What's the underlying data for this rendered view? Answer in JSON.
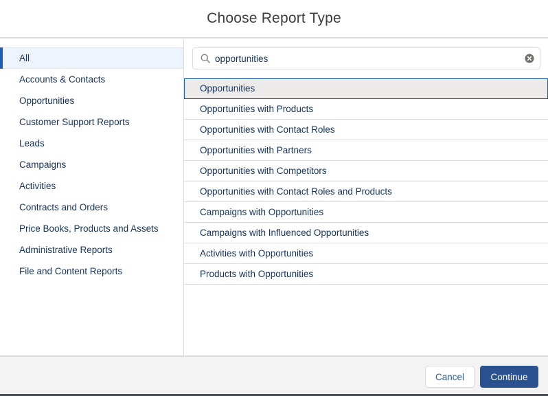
{
  "dialog": {
    "title": "Choose Report Type"
  },
  "sidebar": {
    "items": [
      {
        "label": "All",
        "active": true
      },
      {
        "label": "Accounts & Contacts"
      },
      {
        "label": "Opportunities"
      },
      {
        "label": "Customer Support Reports"
      },
      {
        "label": "Leads"
      },
      {
        "label": "Campaigns"
      },
      {
        "label": "Activities"
      },
      {
        "label": "Contracts and Orders"
      },
      {
        "label": "Price Books, Products and Assets"
      },
      {
        "label": "Administrative Reports"
      },
      {
        "label": "File and Content Reports"
      }
    ]
  },
  "search": {
    "value": "opportunities",
    "icon": "search-icon",
    "clear_icon": "clear-icon"
  },
  "results": {
    "items": [
      {
        "label": "Opportunities",
        "selected": true
      },
      {
        "label": "Opportunities with Products"
      },
      {
        "label": "Opportunities with Contact Roles"
      },
      {
        "label": "Opportunities with Partners"
      },
      {
        "label": "Opportunities with Competitors"
      },
      {
        "label": "Opportunities with Contact Roles and Products"
      },
      {
        "label": "Campaigns with Opportunities"
      },
      {
        "label": "Campaigns with Influenced Opportunities"
      },
      {
        "label": "Activities with Opportunities"
      },
      {
        "label": "Products with Opportunities"
      }
    ]
  },
  "footer": {
    "cancel_label": "Cancel",
    "continue_label": "Continue"
  },
  "colors": {
    "brand": "#2a5190",
    "active_indicator": "#1b5fb9",
    "text": "#16325c"
  }
}
